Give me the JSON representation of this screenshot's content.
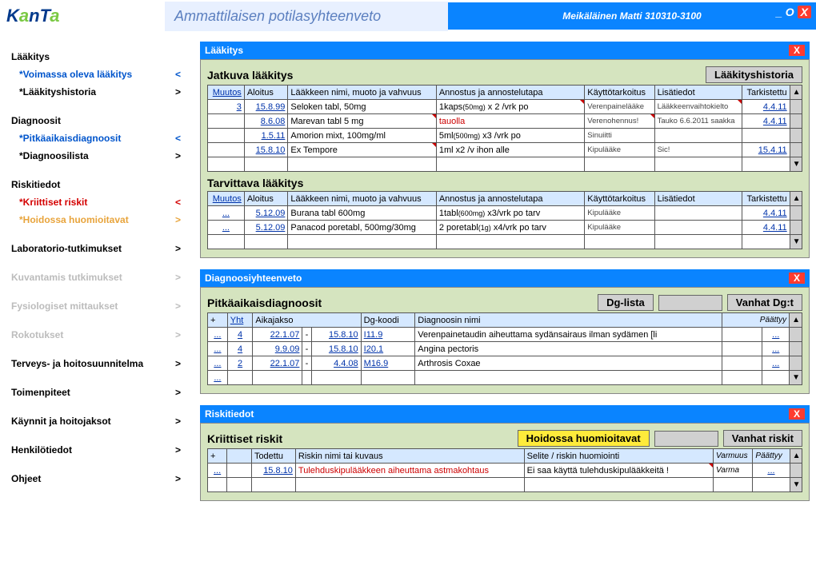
{
  "header": {
    "logo_k": "K",
    "logo_a1": "a",
    "logo_n": "n",
    "logo_t": "T",
    "logo_a2": "a",
    "title": "Ammattilaisen potilasyhteenveto",
    "patient": "Meikäläinen Matti 310310-3100",
    "minimize": "_",
    "circle": "O",
    "close": "X"
  },
  "nav": {
    "laakitys": "Lääkitys",
    "voimassa": "*Voimassa oleva lääkitys",
    "laakhist": "*Lääkityshistoria",
    "diagnoosit": "Diagnoosit",
    "pitkaik": "*Pitkäaikaisdiagnoosit",
    "diaglista": "*Diagnoosilista",
    "riskitiedot": "Riskitiedot",
    "kriittiset": "*Kriittiset riskit",
    "hoidossa": "*Hoidossa huomioitavat",
    "lab": "Laboratorio-tutkimukset",
    "kuvant": "Kuvantamis tutkimukset",
    "fysio": "Fysiologiset mittaukset",
    "rokot": "Rokotukset",
    "terveys": "Terveys- ja hoitosuunnitelma",
    "toimen": "Toimenpiteet",
    "kaynnit": "Käynnit ja hoitojaksot",
    "henkilo": "Henkilötiedot",
    "ohjeet": "Ohjeet",
    "lt": "<",
    "gt": ">"
  },
  "med": {
    "title": "Lääkitys",
    "close": "X",
    "cont_title": "Jatkuva lääkitys",
    "hist_btn": "Lääkityshistoria",
    "h_muutos": "Muutos",
    "h_aloitus": "Aloitus",
    "h_nimi": "Lääkkeen nimi, muoto ja vahvuus",
    "h_annostus": "Annostus ja annostelutapa",
    "h_kaytto": "Käyttötarkoitus",
    "h_lisa": "Lisätiedot",
    "h_tark": "Tarkistettu",
    "arrow_up": "▲",
    "arrow_dn": "▼",
    "rows": [
      {
        "muutos": "3",
        "aloitus": "15.8.99",
        "nimi": "Seloken tabl, 50mg",
        "annostus_a": "1kaps",
        "annostus_b": "(50mg)",
        "annostus_c": " x 2 /vrk po",
        "kaytto": "Verenpainelääke",
        "lisa": "Lääkkeenvaihtokielto",
        "tark": "4.4.11"
      },
      {
        "muutos": "",
        "aloitus": "8.6.08",
        "nimi": "Marevan tabl 5 mg",
        "annostus_a": "tauolla",
        "annostus_b": "",
        "annostus_c": "",
        "kaytto": "Verenohennus!",
        "lisa": "Tauko 6.6.2011 saakka",
        "tark": "4.4.11"
      },
      {
        "muutos": "",
        "aloitus": "1.5.11",
        "nimi": "Amorion mixt, 100mg/ml",
        "annostus_a": "5ml",
        "annostus_b": "(500mg)",
        "annostus_c": " x3 /vrk po",
        "kaytto": "Sinuiitti",
        "lisa": "",
        "tark": ""
      },
      {
        "muutos": "",
        "aloitus": "15.8.10",
        "nimi": "Ex Tempore",
        "annostus_a": "1ml x2 /v ihon alle",
        "annostus_b": "",
        "annostus_c": "",
        "kaytto": "Kipulääke",
        "lisa": "Sic!",
        "tark": "15.4.11"
      }
    ],
    "need_title": "Tarvittava lääkitys",
    "rows2": [
      {
        "muutos": "...",
        "aloitus": "5.12.09",
        "nimi": "Burana tabl 600mg",
        "annostus_a": "1tabl",
        "annostus_b": "(600mg)",
        "annostus_c": " x3/vrk po tarv",
        "kaytto": "Kipulääke",
        "lisa": "",
        "tark": "4.4.11"
      },
      {
        "muutos": "...",
        "aloitus": "5.12.09",
        "nimi": "Panacod poretabl, 500mg/30mg",
        "annostus_a": "2 poretabl",
        "annostus_b": "(1g)",
        "annostus_c": " x4/vrk po tarv",
        "kaytto": "Kipulääke",
        "lisa": "",
        "tark": "4.4.11"
      }
    ]
  },
  "diag": {
    "title": "Diagnoosiyhteenveto",
    "close": "X",
    "sec_title": "Pitkäaikaisdiagnoosit",
    "btn_dg": "Dg-lista",
    "btn_vanhat": "Vanhat Dg:t",
    "h_plus": "+",
    "h_yht": "Yht",
    "h_aika": "Aikajakso",
    "h_koodi": "Dg-koodi",
    "h_nimi": "Diagnoosin nimi",
    "h_paattyy": "Päättyy",
    "rows": [
      {
        "plus": "...",
        "yht": "4",
        "a1": "22.1.07",
        "dash": "-",
        "a2": "15.8.10",
        "koodi": "I11.9",
        "nimi": "Verenpainetaudin aiheuttama sydänsairaus ilman sydämen [li",
        "more": "..."
      },
      {
        "plus": "...",
        "yht": "4",
        "a1": "9.9.09",
        "dash": "-",
        "a2": "15.8.10",
        "koodi": "I20.1",
        "nimi": "Angina pectoris",
        "more": "..."
      },
      {
        "plus": "...",
        "yht": "2",
        "a1": "22.1.07",
        "dash": "-",
        "a2": "4.4.08",
        "koodi": "M16.9",
        "nimi": "Arthrosis Coxae",
        "more": "..."
      }
    ],
    "extra_plus": "..."
  },
  "risk": {
    "title": "Riskitiedot",
    "close": "X",
    "sec_title": "Kriittiset riskit",
    "btn_hoid": "Hoidossa huomioitavat",
    "btn_vanhat": "Vanhat riskit",
    "h_plus": "+",
    "h_todettu": "Todettu",
    "h_nimi": "Riskin nimi tai kuvaus",
    "h_selite": "Selite / riskin huomiointi",
    "h_varmuus": "Varmuus",
    "h_paattyy": "Päättyy",
    "rows": [
      {
        "plus": "...",
        "todettu": "15.8.10",
        "nimi": "Tulehduskipulääkkeen aiheuttama astmakohtaus",
        "selite": "Ei saa käyttä tulehduskipulääkkeitä !",
        "varmuus": "Varma",
        "more": "..."
      }
    ]
  }
}
